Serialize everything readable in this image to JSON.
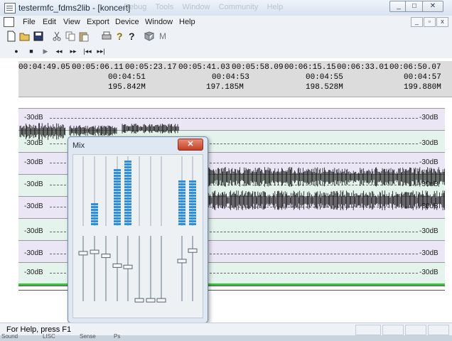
{
  "window": {
    "title": "testermfc_fdms2lib - [koncert]",
    "ghost_menu": [
      "Debug",
      "Tools",
      "Window",
      "Community",
      "Help"
    ],
    "buttons": {
      "minimize": "_",
      "maximize": "□",
      "close": "✕"
    }
  },
  "menu": {
    "items": [
      "File",
      "Edit",
      "View",
      "Export",
      "Device",
      "Window",
      "Help"
    ]
  },
  "mdi_buttons": {
    "minimize": "_",
    "restore": "▫",
    "close": "x"
  },
  "toolbar": {
    "icons": [
      "new-icon",
      "open-icon",
      "save-icon",
      "cut-icon",
      "copy-icon",
      "paste-icon",
      "print-icon",
      "help-icon",
      "context-help-icon",
      "tool-icon",
      "m-icon"
    ],
    "m_label": "M"
  },
  "transport": {
    "icons": [
      "record-icon",
      "stop-icon",
      "play-icon",
      "rewind-icon",
      "fast-forward-icon",
      "go-start-icon",
      "go-end-icon"
    ]
  },
  "ruler": {
    "times_top": [
      "00:04:49.05",
      "00:05:06.11",
      "00:05:23.17",
      "00:05:41.03",
      "00:05:58.09",
      "00:06:15.15",
      "00:06:33.01",
      "00:06:50.07"
    ],
    "times_mid": [
      "00:04:51",
      "00:04:53",
      "00:04:55",
      "00:04:57"
    ],
    "sizes": [
      "195.842M",
      "197.185M",
      "198.528M",
      "199.880M"
    ]
  },
  "tracks": {
    "db_label": "-30dB",
    "right_label": "-30dB",
    "count": 8
  },
  "mixer": {
    "title": "Mix",
    "close": "✕",
    "meter_levels": [
      0,
      0.33,
      0,
      0.83,
      0.96,
      0,
      0,
      0,
      0.66,
      0.66
    ],
    "fader_levels": [
      0.74,
      0.76,
      0.7,
      0.55,
      0.53,
      0.02,
      0.02,
      0.02,
      0.62,
      0.78
    ]
  },
  "status": {
    "text": "For Help, press F1"
  },
  "taskbar": {
    "items": [
      "Sound",
      "LISC",
      "Sense",
      "Ps"
    ]
  }
}
